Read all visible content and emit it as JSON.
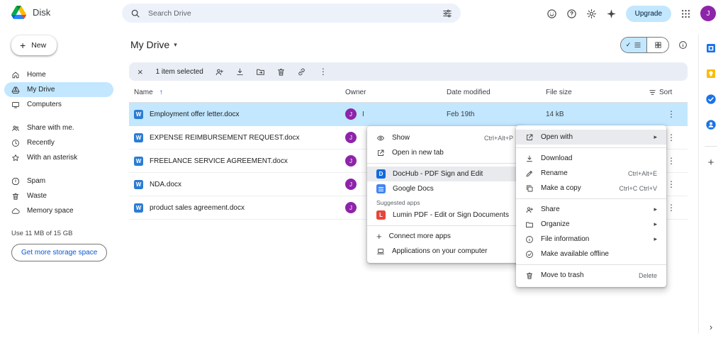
{
  "icons": {
    "more_vertical": "⋮",
    "close": "×",
    "submenu_arrow": "▸",
    "caret_down": "▾",
    "sort_ascending": "↑",
    "check": "✓",
    "plus": "+",
    "chevron_right": "›",
    "help": "?",
    "word_badge": "W",
    "dochub_badge": "D",
    "lumin_badge": "L"
  },
  "topbar": {
    "app_name": "Disk",
    "search_placeholder": "Search Drive",
    "upgrade_label": "Upgrade",
    "avatar_initial": "J"
  },
  "sidebar": {
    "new_label": "New",
    "items": [
      "Home",
      "My Drive",
      "Computers",
      "Share with me.",
      "Recently",
      "With an asterisk",
      "Spam",
      "Waste",
      "Memory space"
    ],
    "storage_usage": "Use 11 MB of 15 GB",
    "storage_button": "Get more storage space"
  },
  "main": {
    "title": "My Drive",
    "selection_text": "1 item selected",
    "columns": {
      "name": "Name",
      "owner": "Owner",
      "date": "Date modified",
      "size": "File size",
      "sort": "Sort"
    },
    "rows": [
      {
        "name": "Employment offer letter.docx",
        "avatar": "J",
        "owner": "I",
        "date": "Feb 19th",
        "size": "14 kB"
      },
      {
        "name": "EXPENSE REIMBURSEMENT REQUEST.docx",
        "avatar": "J"
      },
      {
        "name": "FREELANCE SERVICE AGREEMENT.docx",
        "avatar": "J"
      },
      {
        "name": "NDA.docx",
        "avatar": "J"
      },
      {
        "name": "product sales agreement.docx",
        "avatar": "J"
      }
    ]
  },
  "open_with_menu": {
    "section_label": "Suggested apps",
    "items": [
      {
        "label": "Show",
        "shortcut": "Ctrl+Alt+P"
      },
      {
        "label": "Open in new tab"
      },
      {
        "label": "DocHub - PDF Sign and Edit"
      },
      {
        "label": "Google Docs"
      },
      {
        "label": "Lumin PDF - Edit or Sign Documents"
      },
      {
        "label": "Connect more apps"
      },
      {
        "label": "Applications on your computer"
      }
    ]
  },
  "context_menu": {
    "items": [
      {
        "label": "Open with"
      },
      {
        "label": "Download"
      },
      {
        "label": "Rename",
        "shortcut": "Ctrl+Alt+E"
      },
      {
        "label": "Make a copy",
        "shortcut": "Ctrl+C Ctrl+V"
      },
      {
        "label": "Share"
      },
      {
        "label": "Organize"
      },
      {
        "label": "File information"
      },
      {
        "label": "Make available offline"
      },
      {
        "label": "Move to trash",
        "shortcut": "Delete"
      }
    ]
  },
  "colors": {
    "selection_blue": "#c2e7ff",
    "accent_blue": "#0b57d0",
    "word_blue": "#2b7cd3",
    "avatar_purple": "#8e24aa"
  }
}
